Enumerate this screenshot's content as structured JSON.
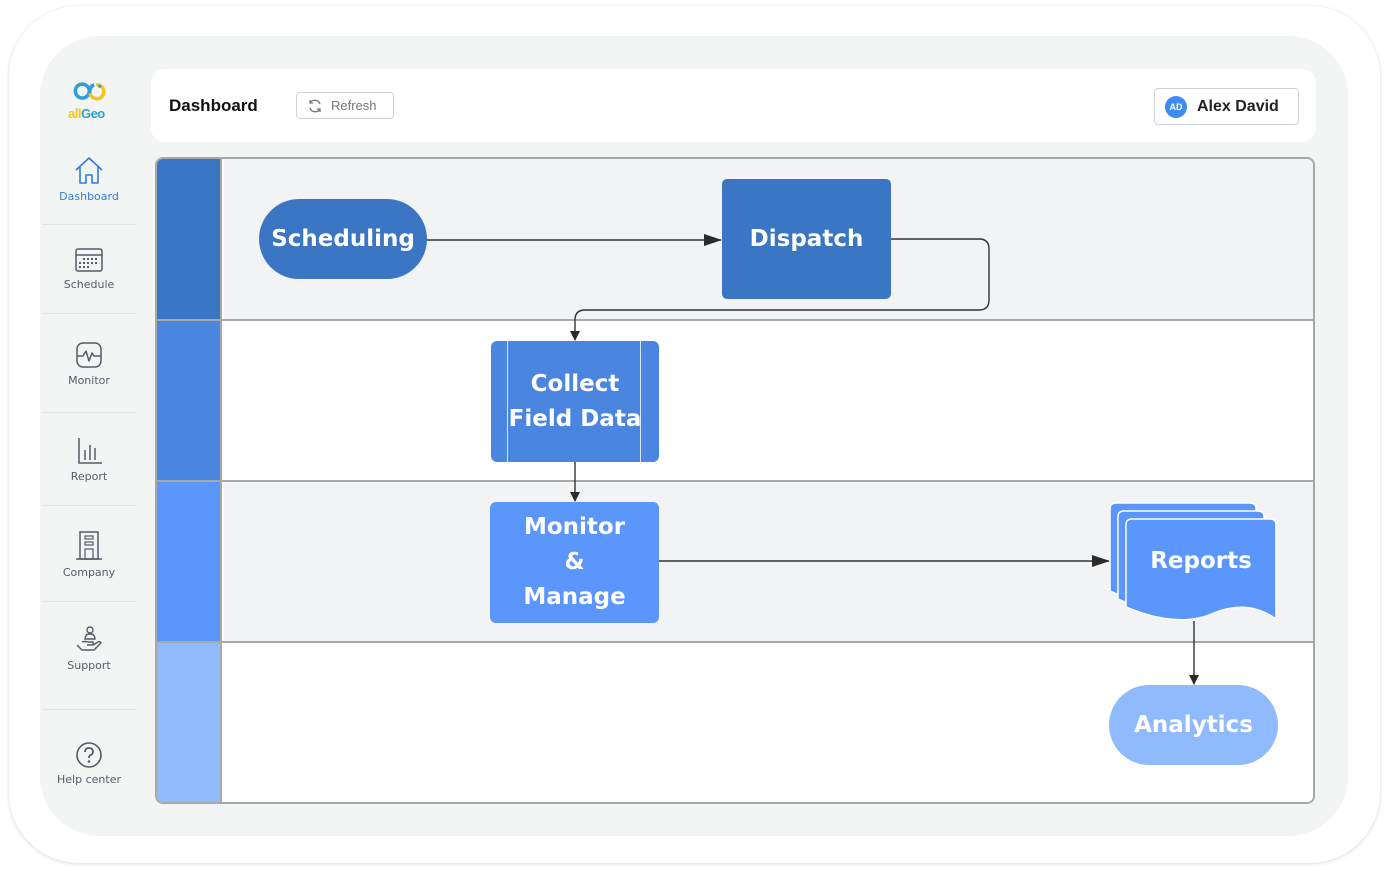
{
  "app": {
    "logo": {
      "part1": "all",
      "part2": "Geo",
      "colors": {
        "ring_blue": "#2e9fd8",
        "ring_yellow": "#f5c518"
      }
    }
  },
  "sidebar": {
    "items": [
      {
        "label": "Dashboard",
        "icon": "home-icon",
        "active": true
      },
      {
        "label": "Schedule",
        "icon": "calendar-icon",
        "active": false
      },
      {
        "label": "Monitor",
        "icon": "monitor-pulse-icon",
        "active": false
      },
      {
        "label": "Report",
        "icon": "bar-chart-icon",
        "active": false
      },
      {
        "label": "Company",
        "icon": "building-icon",
        "active": false
      },
      {
        "label": "Support",
        "icon": "hand-person-icon",
        "active": false
      },
      {
        "label": "Help center",
        "icon": "question-circle-icon",
        "active": false
      }
    ],
    "accent": "#2f7de1"
  },
  "header": {
    "title": "Dashboard",
    "refresh_label": "Refresh",
    "user": {
      "initials": "AD",
      "name": "Alex David"
    }
  },
  "diagram": {
    "lanes": [
      {
        "color": "#3a76c3",
        "body": "#f2f3f5"
      },
      {
        "color": "#4a86df",
        "body": "#ffffff"
      },
      {
        "color": "#5a96fb",
        "body": "#f2f3f5"
      },
      {
        "color": "#8fbafd",
        "body": "#ffffff"
      }
    ],
    "nodes": {
      "scheduling": {
        "label": "Scheduling",
        "shape": "terminator",
        "color": "#3a76c3"
      },
      "dispatch": {
        "label": "Dispatch",
        "shape": "process",
        "color": "#3a76c3"
      },
      "collect": {
        "line1": "Collect",
        "line2": "Field Data",
        "shape": "predefined-process",
        "color": "#4a86df"
      },
      "monitor": {
        "line1": "Monitor",
        "line2": "&",
        "line3": "Manage",
        "shape": "process",
        "color": "#5a96fb"
      },
      "reports": {
        "label": "Reports",
        "shape": "multi-document",
        "color": "#5a96fb"
      },
      "analytics": {
        "label": "Analytics",
        "shape": "terminator",
        "color": "#8fbafd"
      }
    },
    "edges": [
      {
        "from": "Scheduling",
        "to": "Dispatch"
      },
      {
        "from": "Dispatch",
        "to": "Collect Field Data"
      },
      {
        "from": "Collect Field Data",
        "to": "Monitor & Manage"
      },
      {
        "from": "Monitor & Manage",
        "to": "Reports"
      },
      {
        "from": "Reports",
        "to": "Analytics"
      }
    ]
  }
}
